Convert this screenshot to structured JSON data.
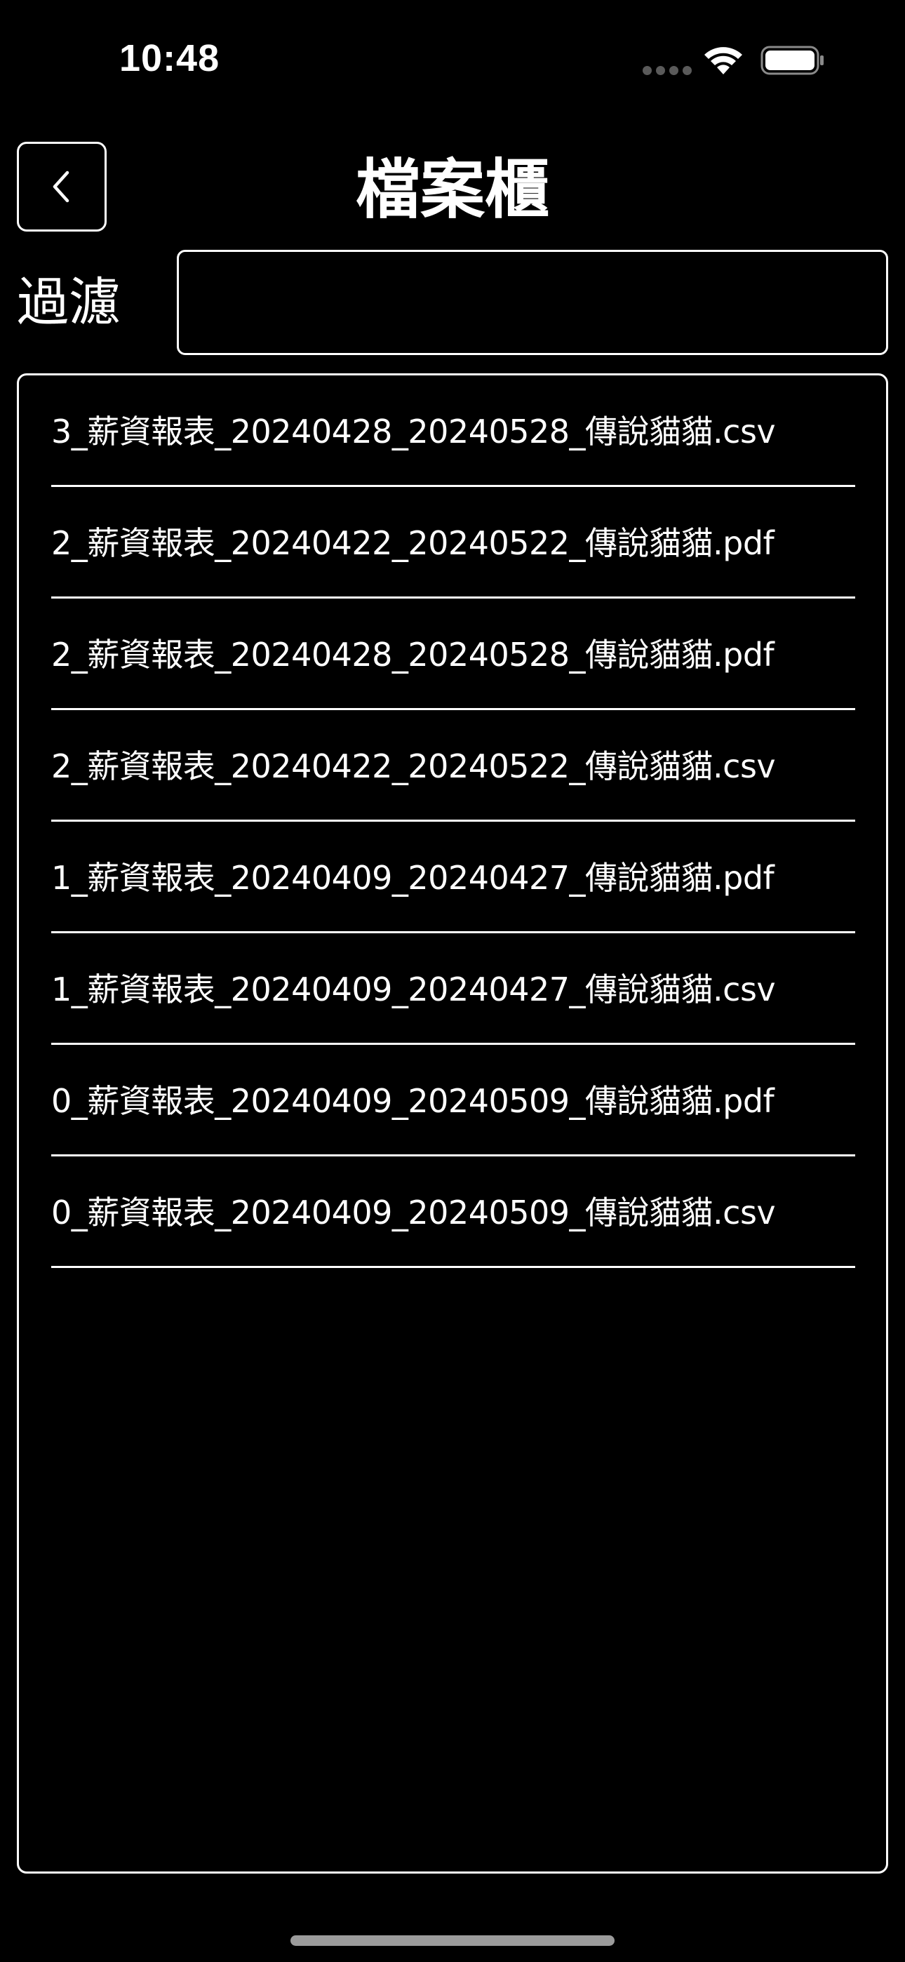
{
  "status_bar": {
    "time": "10:48"
  },
  "header": {
    "title": "檔案櫃",
    "back_icon": "chevron-left-icon"
  },
  "filter": {
    "label": "過濾",
    "value": "",
    "placeholder": ""
  },
  "files": [
    "3_薪資報表_20240428_20240528_傳說貓貓.csv",
    "2_薪資報表_20240422_20240522_傳說貓貓.pdf",
    "2_薪資報表_20240428_20240528_傳說貓貓.pdf",
    "2_薪資報表_20240422_20240522_傳說貓貓.csv",
    "1_薪資報表_20240409_20240427_傳說貓貓.pdf",
    "1_薪資報表_20240409_20240427_傳說貓貓.csv",
    "0_薪資報表_20240409_20240509_傳說貓貓.pdf",
    "0_薪資報表_20240409_20240509_傳說貓貓.csv"
  ],
  "colors": {
    "background": "#000000",
    "foreground": "#ffffff"
  }
}
